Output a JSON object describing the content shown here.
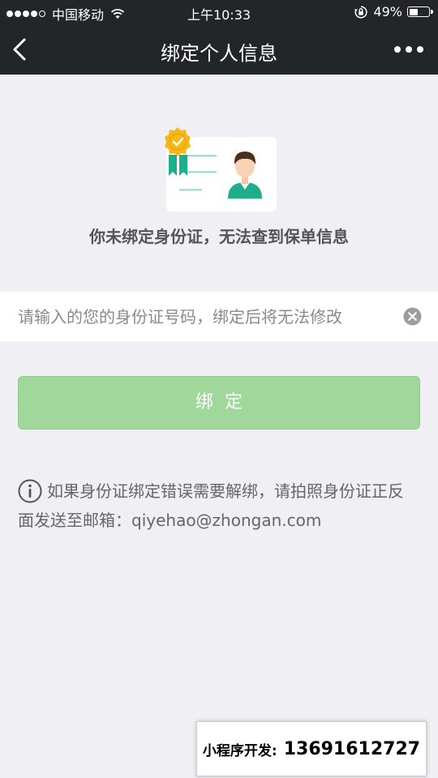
{
  "status_bar": {
    "carrier": "中国移动",
    "time": "上午10:33",
    "battery": "49%",
    "battery_level": 0.49
  },
  "nav": {
    "title": "绑定个人信息"
  },
  "empty_state": {
    "message": "你未绑定身份证，无法查到保单信息"
  },
  "id_input": {
    "value": "",
    "placeholder": "请输入的您的身份证号码，绑定后将无法修改"
  },
  "bind_button": {
    "label": "绑定"
  },
  "notice": {
    "text": "如果身份证绑定错误需要解绑，请拍照身份证正反面发送至邮箱：qiyehao@zhongan.com"
  },
  "dev_banner": {
    "label": "小程序开发:",
    "phone": "13691612727"
  },
  "colors": {
    "nav_background": "#232628",
    "page_background": "#efeff4",
    "button_green": "#a0d89c",
    "badge_gold": "#f5b816",
    "avatar_teal": "#1fae8a"
  }
}
